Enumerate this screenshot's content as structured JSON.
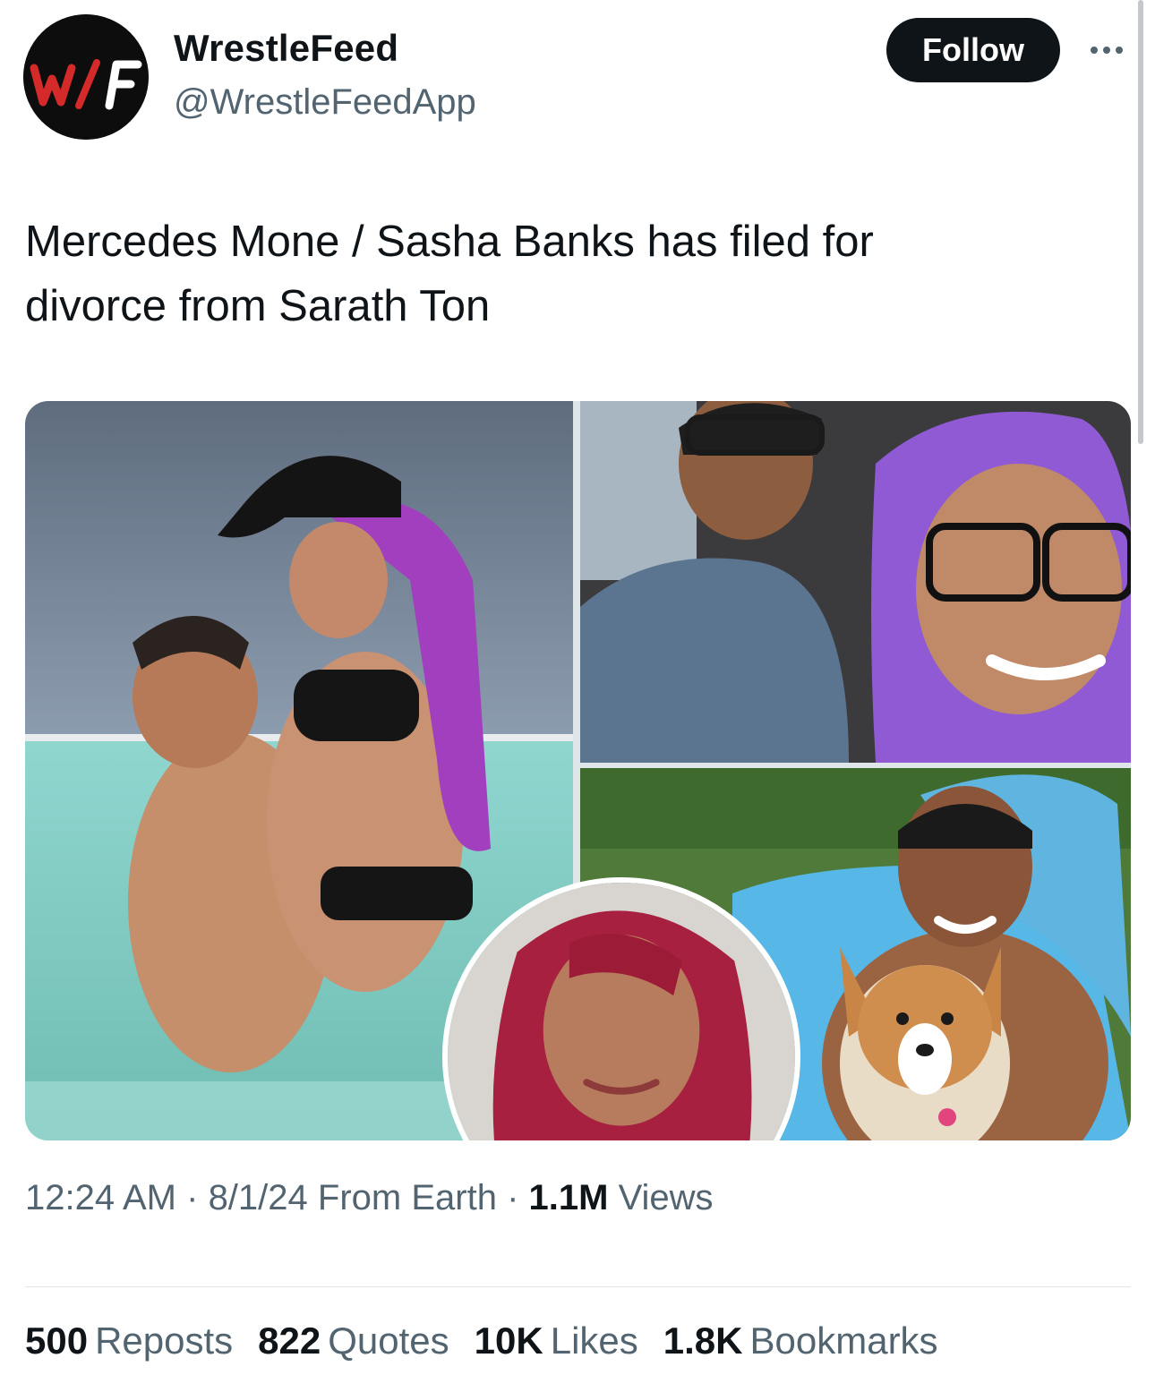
{
  "author": {
    "display_name": "WrestleFeed",
    "handle": "@WrestleFeedApp",
    "avatar_logo_text": "W/F"
  },
  "actions": {
    "follow_label": "Follow",
    "more_icon": "more-horizontal-icon"
  },
  "tweet": {
    "text_line1": "Mercedes Mone / Sasha Banks has filed for",
    "text_line2": "divorce from Sarath Ton"
  },
  "meta": {
    "time": "12:24 AM",
    "sep1": " · ",
    "date": "8/1/24",
    "source": "From Earth",
    "sep2": " · ",
    "views_count": "1.1M",
    "views_label": "Views"
  },
  "stats": [
    {
      "count": "500",
      "label": "Reposts"
    },
    {
      "count": "822",
      "label": "Quotes"
    },
    {
      "count": "10K",
      "label": "Likes"
    },
    {
      "count": "1.8K",
      "label": "Bookmarks"
    }
  ],
  "colors": {
    "text": "#0f1419",
    "secondary": "#536471",
    "logo_red": "#d42a2a"
  }
}
